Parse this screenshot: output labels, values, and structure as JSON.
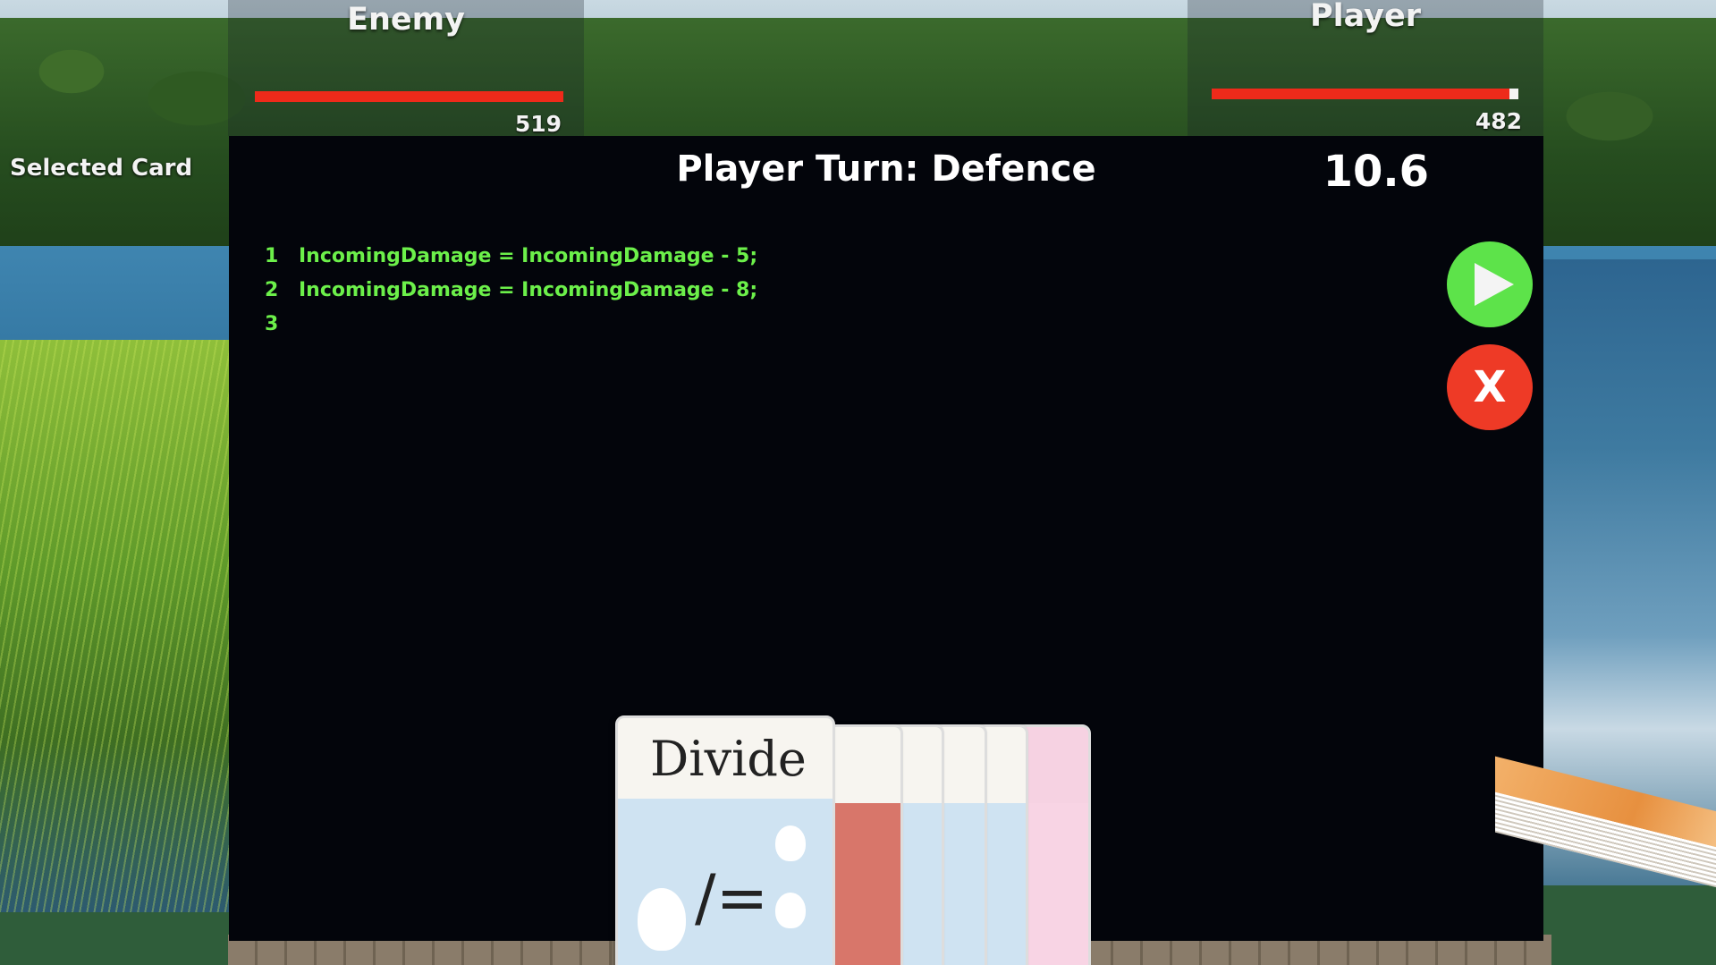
{
  "enemy": {
    "label": "Enemy",
    "hp": "519",
    "hp_fraction": 1.0
  },
  "player": {
    "label": "Player",
    "hp": "482",
    "hp_fraction": 0.97
  },
  "sidebar": {
    "selected_card_label": "Selected Card"
  },
  "turn": {
    "title": "Player Turn: Defence",
    "timer": "10.6"
  },
  "code": {
    "lines": [
      {
        "num": "1",
        "text": "IncomingDamage = IncomingDamage - 5;"
      },
      {
        "num": "2",
        "text": "IncomingDamage = IncomingDamage - 8;"
      },
      {
        "num": "3",
        "text": ""
      }
    ]
  },
  "controls": {
    "run_icon": "play-icon",
    "clear_label": "X",
    "run_color": "#5de34a",
    "clear_color": "#ee3a26"
  },
  "hand": {
    "selected_card": {
      "title": "Divide",
      "operator": "/="
    },
    "cards": [
      "Divide",
      "",
      "",
      "",
      "",
      ""
    ]
  },
  "colors": {
    "hp_bar": "#ee2a1a",
    "code_text": "#6cf04a",
    "panel_bg": "#03050b"
  }
}
